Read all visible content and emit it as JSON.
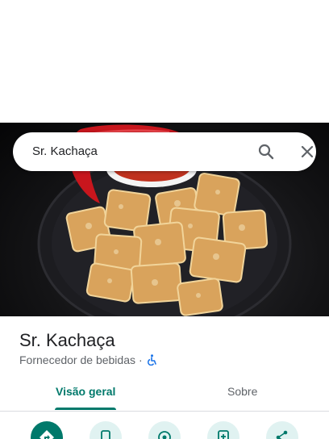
{
  "search": {
    "query": "Sr. Kachaça"
  },
  "place": {
    "name": "Sr. Kachaça",
    "category": "Fornecedor de bebidas",
    "separator": "·"
  },
  "tabs": [
    {
      "label": "Visão geral",
      "active": true
    },
    {
      "label": "Sobre",
      "active": false
    }
  ],
  "actions": [
    {
      "icon": "directions-icon"
    },
    {
      "icon": "phone-icon"
    },
    {
      "icon": "live-view-icon"
    },
    {
      "icon": "save-icon"
    },
    {
      "icon": "share-icon"
    }
  ],
  "colors": {
    "accent": "#00796b",
    "accent_light": "#e0f2f1",
    "accessibility": "#1a73e8"
  }
}
